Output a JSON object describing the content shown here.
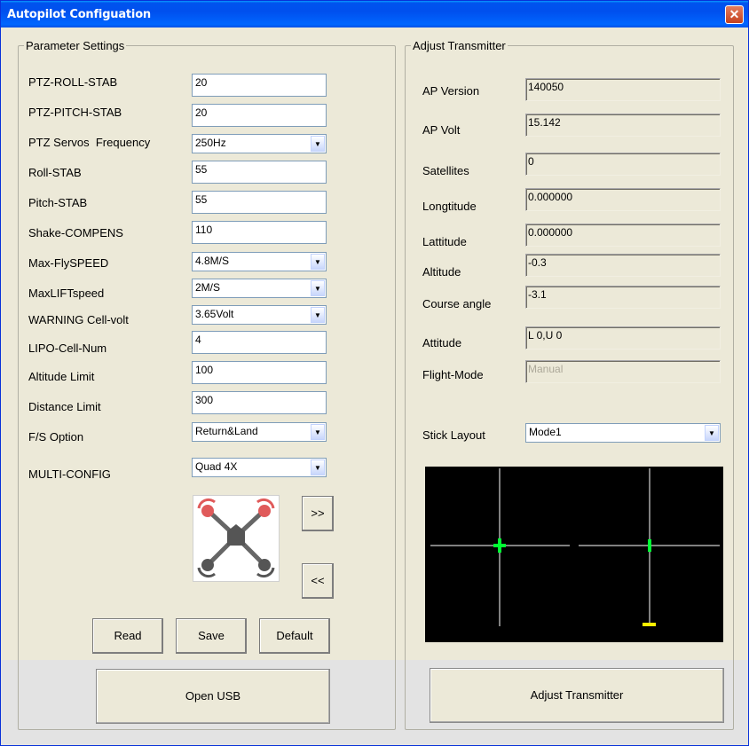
{
  "window": {
    "title": "Autopilot Configuation",
    "close_symbol": "✕"
  },
  "parameter_settings": {
    "legend": "Parameter Settings",
    "fields": [
      {
        "label": "PTZ-ROLL-STAB",
        "value": "20",
        "kind": "text"
      },
      {
        "label": "PTZ-PITCH-STAB",
        "value": "20",
        "kind": "text"
      },
      {
        "label": "PTZ Servos  Frequency",
        "value": "250Hz",
        "kind": "select"
      },
      {
        "label": "Roll-STAB",
        "value": "55",
        "kind": "text"
      },
      {
        "label": "Pitch-STAB",
        "value": "55",
        "kind": "text"
      },
      {
        "label": "Shake-COMPENS",
        "value": "110",
        "kind": "text"
      },
      {
        "label": "Max-FlySPEED",
        "value": "4.8M/S",
        "kind": "select"
      },
      {
        "label": "MaxLIFTspeed",
        "value": "2M/S",
        "kind": "select"
      },
      {
        "label": "WARNING Cell-volt",
        "value": "3.65Volt",
        "kind": "select"
      },
      {
        "label": "LIPO-Cell-Num",
        "value": "4",
        "kind": "text"
      },
      {
        "label": "Altitude Limit",
        "value": "100",
        "kind": "text"
      },
      {
        "label": "Distance Limit",
        "value": "300",
        "kind": "text"
      },
      {
        "label": "F/S Option",
        "value": "Return&Land",
        "kind": "select"
      },
      {
        "label": "MULTI-CONFIG",
        "value": "Quad 4X",
        "kind": "select"
      }
    ],
    "next_label": ">>",
    "prev_label": "<<",
    "read_label": "Read",
    "save_label": "Save",
    "default_label": "Default",
    "open_usb_label": "Open USB"
  },
  "adjust_transmitter": {
    "legend": "Adjust Transmitter",
    "fields": [
      {
        "label": "AP Version",
        "value": "140050"
      },
      {
        "label": "AP Volt",
        "value": "15.142"
      },
      {
        "label": "Satellites",
        "value": "0"
      },
      {
        "label": "Longtitude",
        "value": "0.000000"
      },
      {
        "label": "Lattitude",
        "value": "0.000000"
      },
      {
        "label": "Altitude",
        "value": "-0.3"
      },
      {
        "label": "Course angle",
        "value": "-3.1"
      },
      {
        "label": "Attitude",
        "value": "L 0,U 0"
      },
      {
        "label": "Flight-Mode",
        "value": "Manual"
      }
    ],
    "stick_layout_label": "Stick Layout",
    "stick_layout_value": "Mode1",
    "adjust_button_label": "Adjust Transmitter"
  },
  "colors": {
    "stick_marker": "#00ff33",
    "throttle_marker": "#ffee00",
    "crosshair": "#ffffff",
    "motor_cw": "#e05a5a",
    "motor_ccw": "#555555"
  }
}
